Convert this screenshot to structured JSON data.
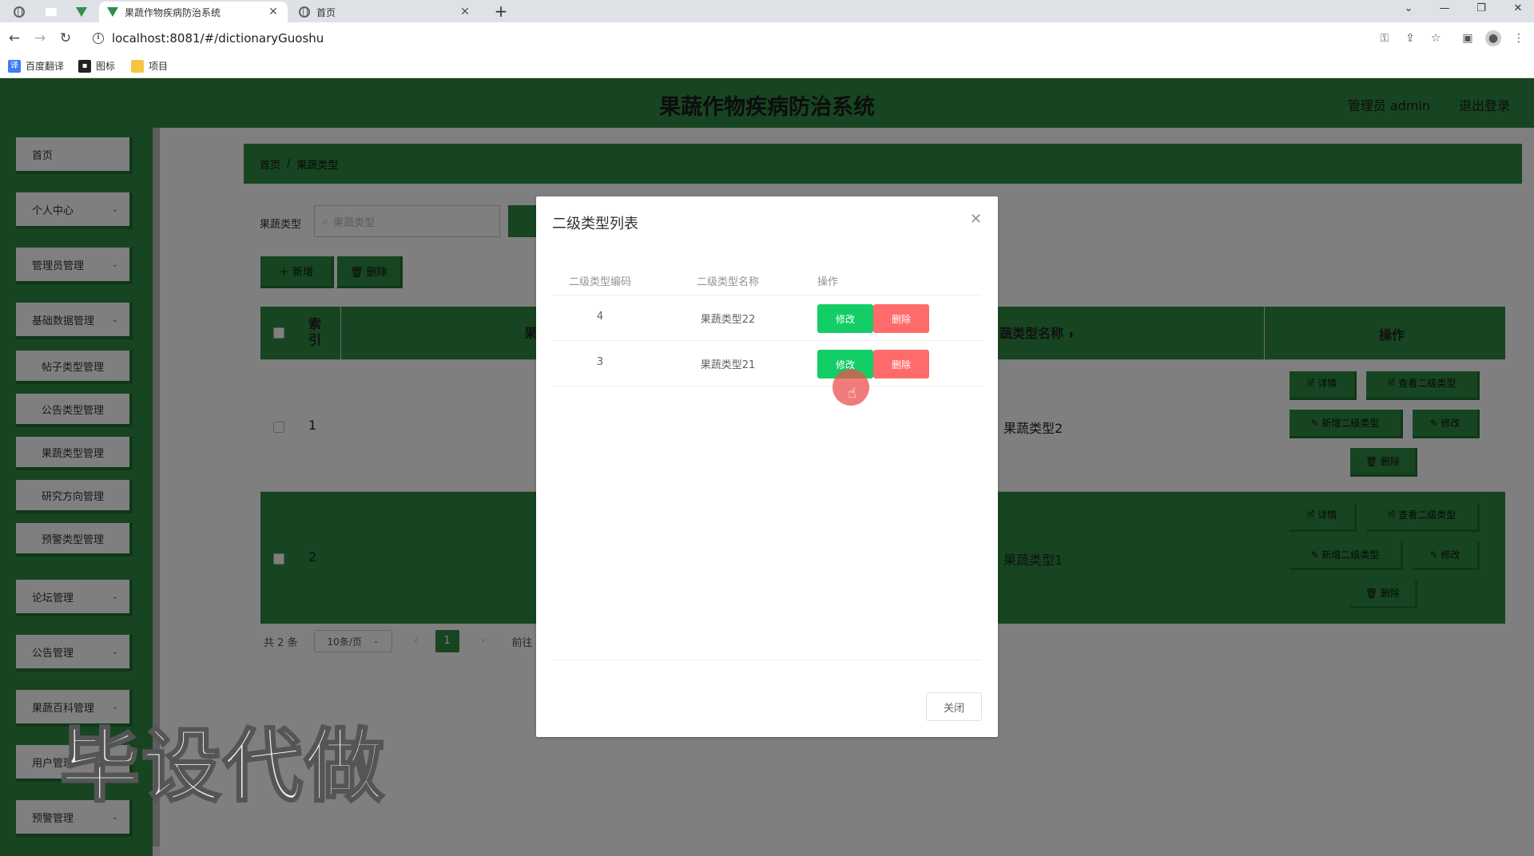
{
  "browser": {
    "tabs": [
      {
        "title": "果蔬作物疾病防治系统",
        "active": true
      },
      {
        "title": "首页",
        "active": false
      }
    ],
    "url": "localhost:8081/#/dictionaryGuoshu",
    "bookmarks": [
      "百度翻译",
      "图标",
      "项目"
    ]
  },
  "app": {
    "title": "果蔬作物疾病防治系统",
    "user": "管理员 admin",
    "logout": "退出登录"
  },
  "sidebar": {
    "items": [
      {
        "label": "首页",
        "sub": false,
        "chevron": false
      },
      {
        "label": "个人中心",
        "sub": false,
        "chevron": true
      },
      {
        "label": "管理员管理",
        "sub": false,
        "chevron": true
      },
      {
        "label": "基础数据管理",
        "sub": false,
        "chevron": true
      },
      {
        "label": "帖子类型管理",
        "sub": true,
        "chevron": false
      },
      {
        "label": "公告类型管理",
        "sub": true,
        "chevron": false
      },
      {
        "label": "果蔬类型管理",
        "sub": true,
        "chevron": false
      },
      {
        "label": "研究方向管理",
        "sub": true,
        "chevron": false
      },
      {
        "label": "预警类型管理",
        "sub": true,
        "chevron": false
      },
      {
        "label": "论坛管理",
        "sub": false,
        "chevron": true
      },
      {
        "label": "公告管理",
        "sub": false,
        "chevron": true
      },
      {
        "label": "果蔬百科管理",
        "sub": false,
        "chevron": true
      },
      {
        "label": "用户管理",
        "sub": false,
        "chevron": true
      },
      {
        "label": "预警管理",
        "sub": false,
        "chevron": true
      }
    ]
  },
  "breadcrumb": {
    "home": "首页",
    "sep": "/",
    "current": "果蔬类型"
  },
  "search": {
    "label": "果蔬类型",
    "placeholder": "果蔬类型"
  },
  "toolbar": {
    "add": "＋ 新增",
    "delete": "🗑 删除"
  },
  "grid": {
    "head": {
      "index": "索引",
      "name_col_left": "果",
      "name_col": "蔬类型名称",
      "ops": "操作"
    },
    "rows": [
      {
        "index": "1",
        "name": "果蔬类型2"
      },
      {
        "index": "2",
        "name": "果蔬类型1"
      }
    ],
    "row_ops": {
      "detail": "🗎 详情",
      "view_sub": "🗎 查看二级类型",
      "add_sub": "✎ 新增二级类型",
      "edit": "✎ 修改",
      "delete": "🗑 删除"
    }
  },
  "pager": {
    "total": "共 2 条",
    "size": "10条/页",
    "current": "1",
    "goto": "前往"
  },
  "dialog": {
    "title": "二级类型列表",
    "columns": [
      "二级类型编码",
      "二级类型名称",
      "操作"
    ],
    "rows": [
      {
        "code": "4",
        "name": "果蔬类型22"
      },
      {
        "code": "3",
        "name": "果蔬类型21"
      }
    ],
    "edit_label": "修改",
    "delete_label": "删除",
    "close_label": "关闭"
  },
  "watermark": "毕设代做",
  "colors": {
    "brand_green": "#2e8b42",
    "edit_green": "#13ce66",
    "delete_red": "#ff6b6b"
  }
}
